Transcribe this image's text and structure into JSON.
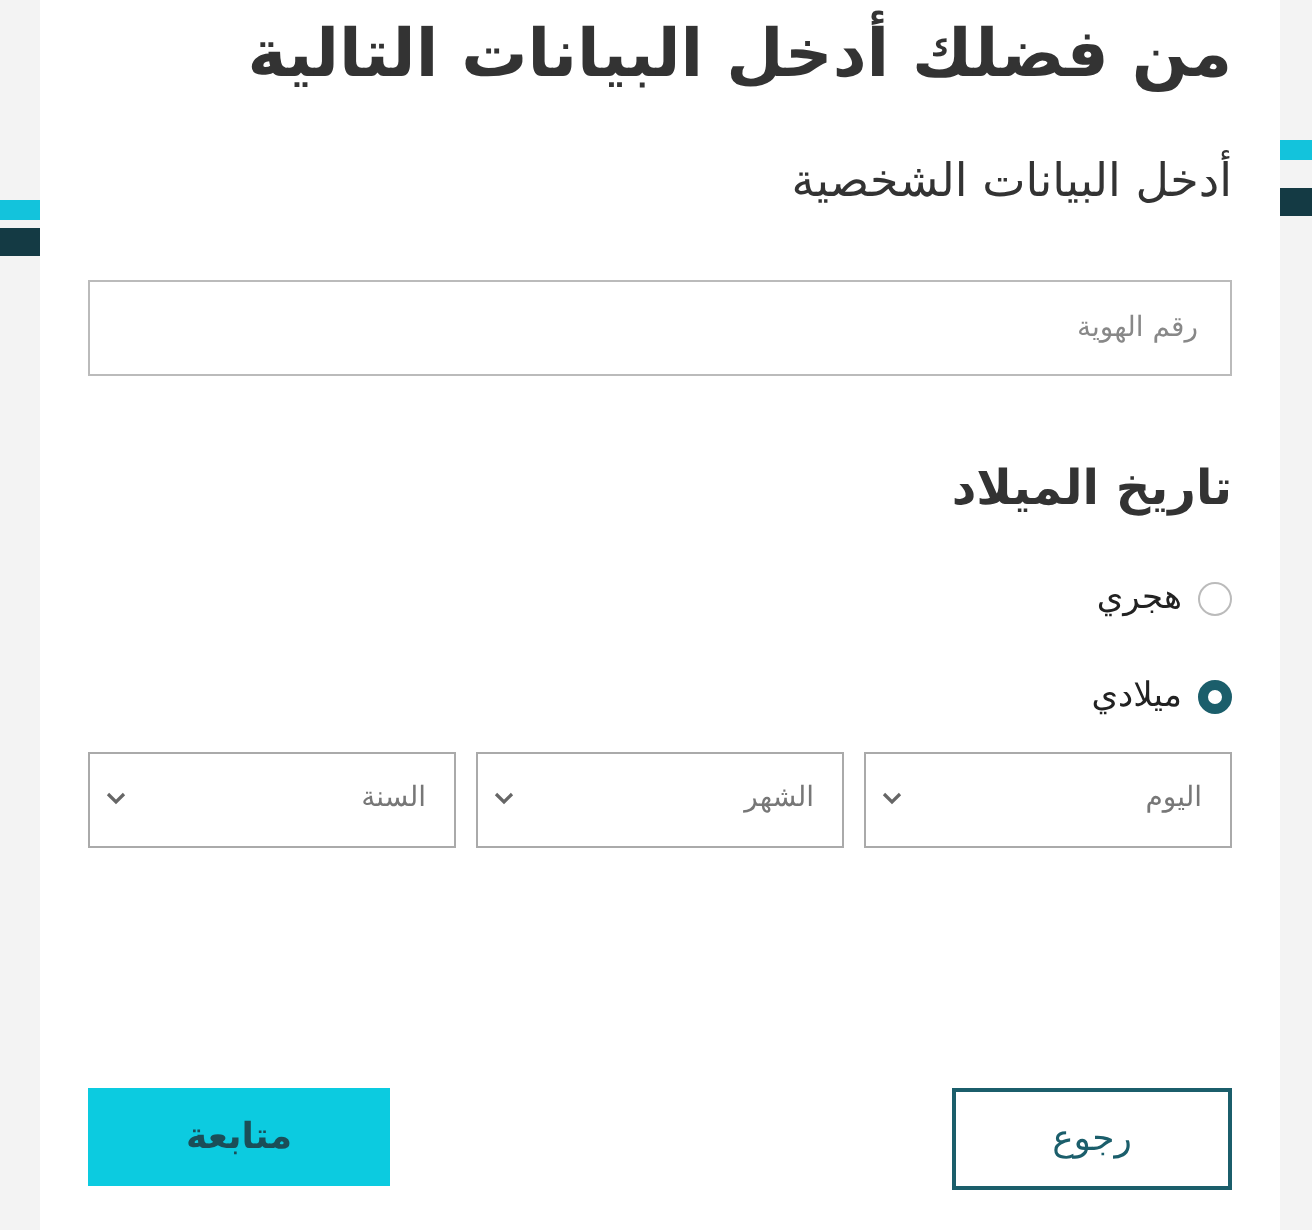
{
  "title": "من فضلك أدخل البيانات التالية",
  "subtitle": "أدخل البيانات الشخصية",
  "id_field": {
    "placeholder": "رقم الهوية"
  },
  "birth_date": {
    "heading": "تاريخ الميلاد",
    "calendars": [
      {
        "label": "هجري",
        "selected": false
      },
      {
        "label": "ميلادي",
        "selected": true
      }
    ],
    "selects": [
      {
        "placeholder": "اليوم"
      },
      {
        "placeholder": "الشهر"
      },
      {
        "placeholder": "السنة"
      }
    ]
  },
  "buttons": [
    {
      "label": "رجوع",
      "kind": "outline"
    },
    {
      "label": "متابعة",
      "kind": "primary"
    }
  ]
}
